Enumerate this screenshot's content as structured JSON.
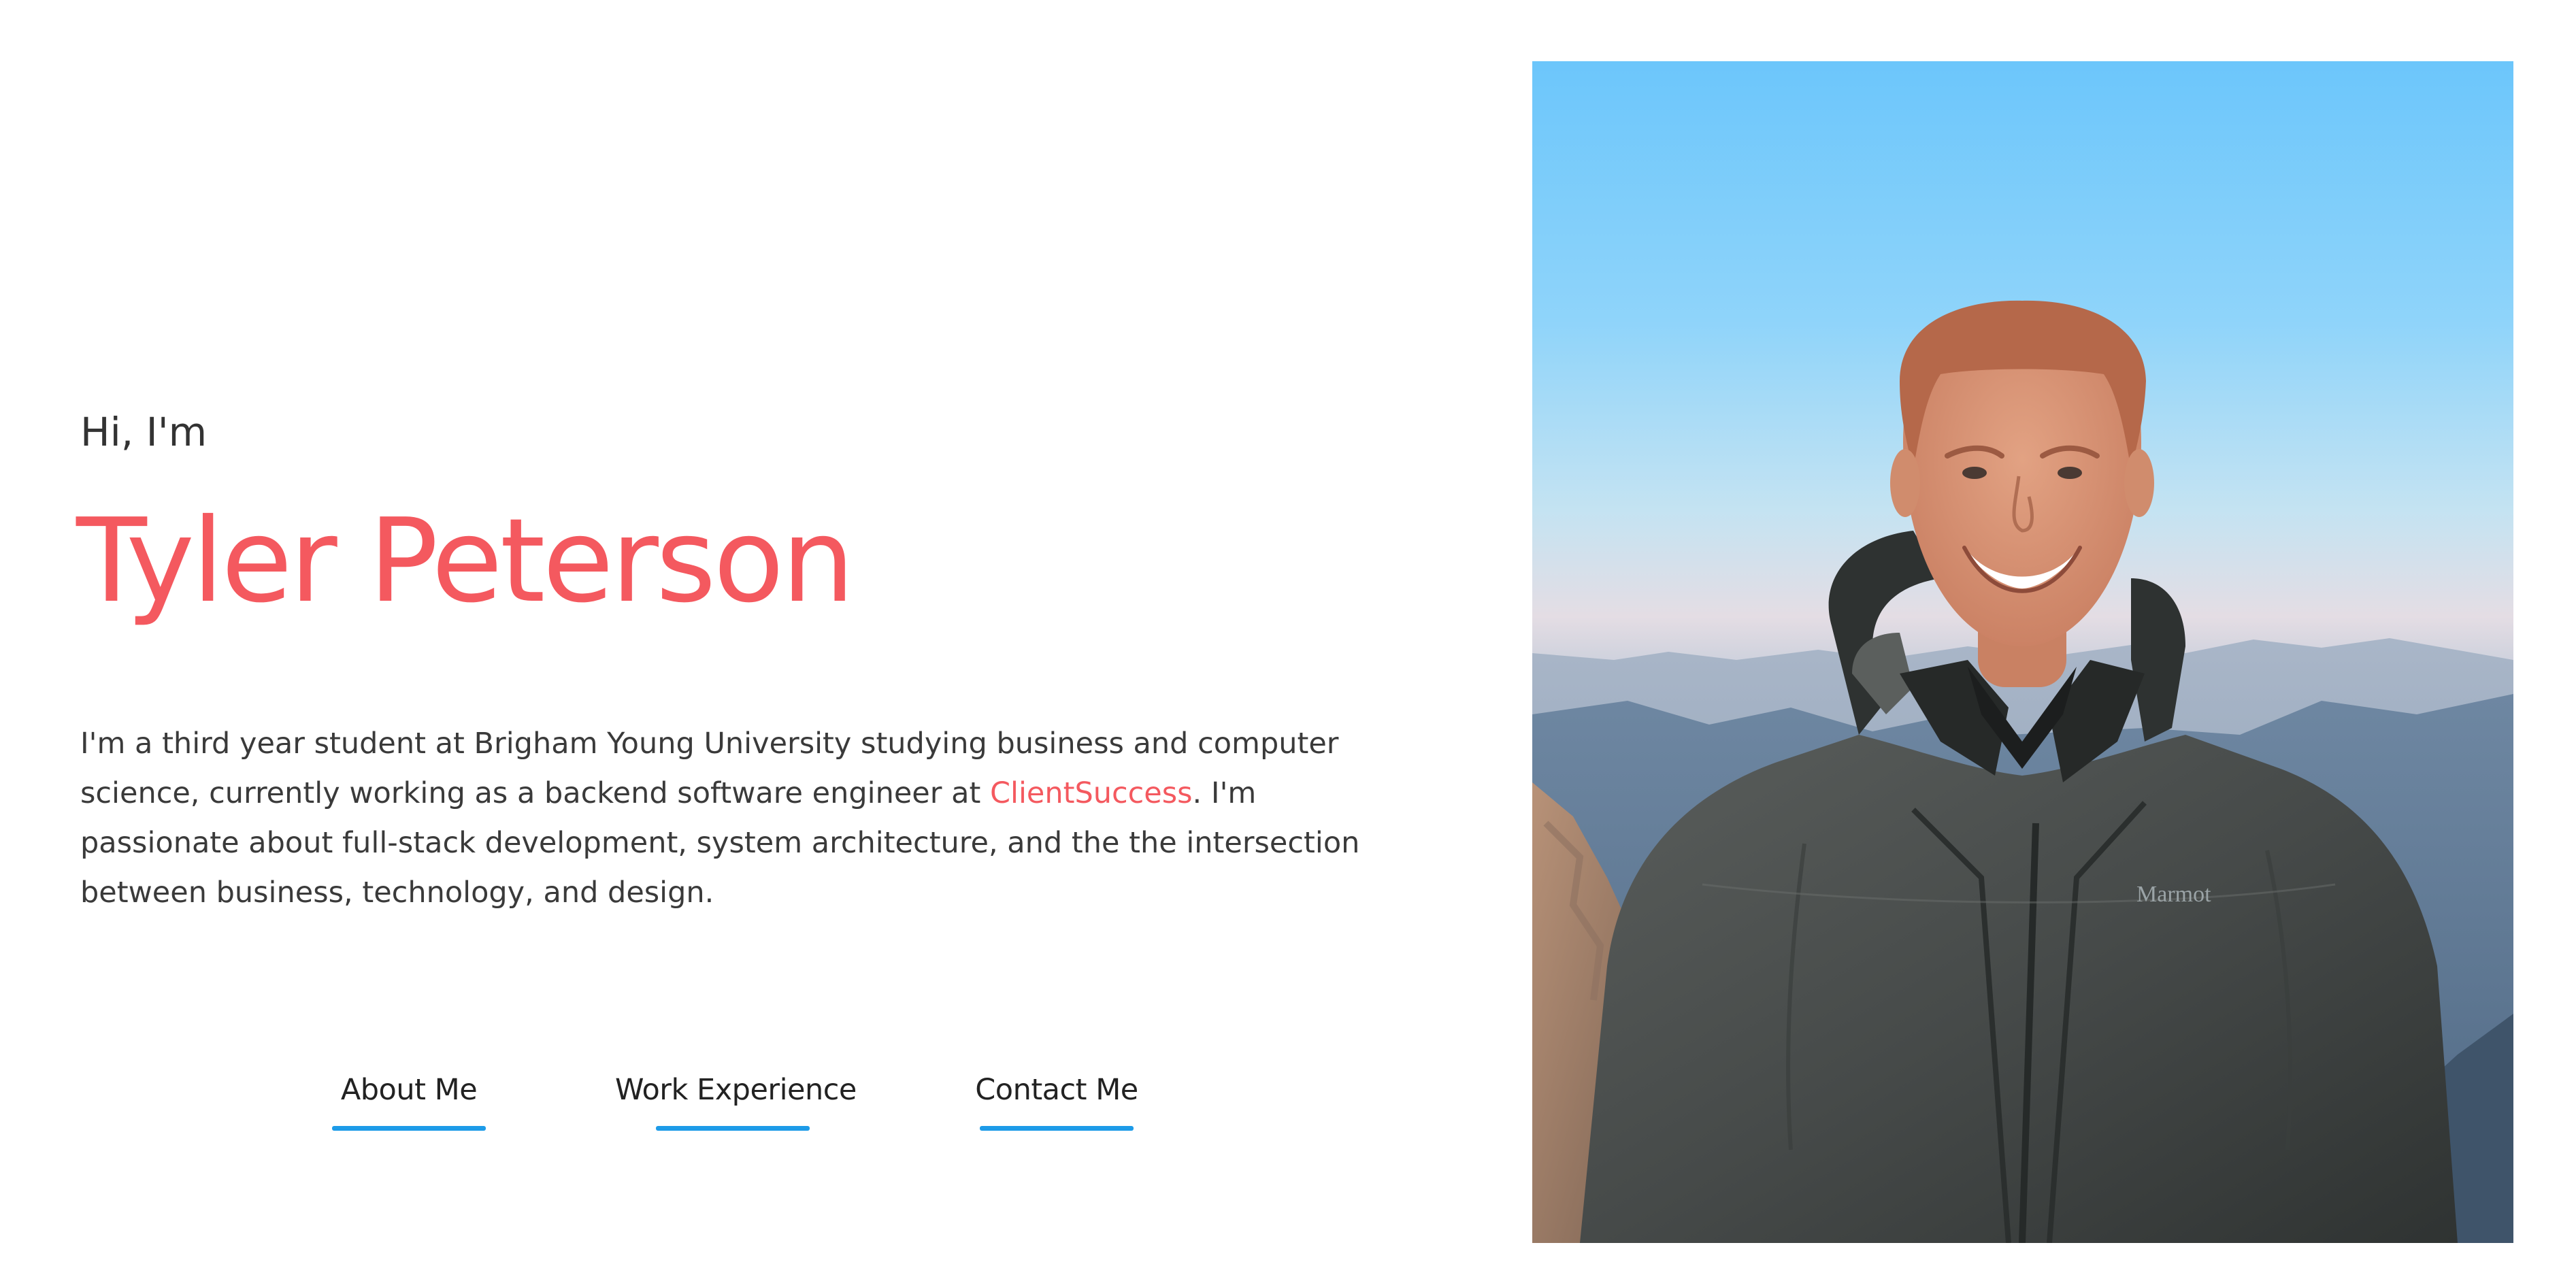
{
  "hero": {
    "greeting": "Hi, I'm",
    "name": "Tyler Peterson",
    "bio": {
      "before_link": "I'm a third year student at Brigham Young University studying business and computer science, currently working as a backend software engineer at ",
      "link_text": "ClientSuccess",
      "after_link": ". I'm passionate about full-stack development, system architecture, and the the intersection between business, technology, and design."
    }
  },
  "nav": {
    "about": "About Me",
    "work": "Work Experience",
    "contact": "Contact Me"
  },
  "colors": {
    "accent": "#f4595f",
    "underline": "#1d9be8",
    "text": "#333333"
  },
  "photo": {
    "jacket_brand": "Marmot"
  }
}
